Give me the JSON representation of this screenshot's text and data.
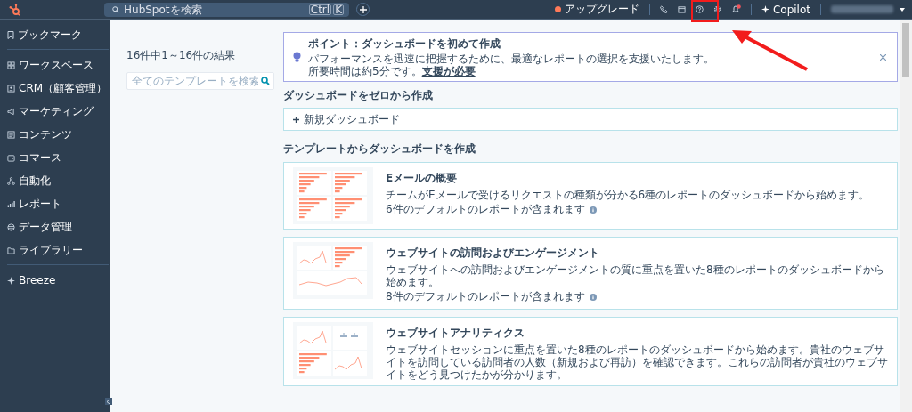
{
  "topbar": {
    "search": {
      "placeholder": "HubSpotを検索",
      "shortcut": [
        "Ctrl",
        "K"
      ]
    },
    "upgrade": "アップグレード",
    "copilot": "Copilot"
  },
  "sidebar": {
    "bookmarks": "ブックマーク",
    "items": [
      "ワークスペース",
      "CRM（顧客管理）",
      "マーケティング",
      "コンテンツ",
      "コマース",
      "自動化",
      "レポート",
      "データ管理",
      "ライブラリー"
    ],
    "breeze": "Breeze"
  },
  "filters": {
    "result_count": "16件中1～16件の結果",
    "search": {
      "placeholder": "全てのテンプレートを検索"
    }
  },
  "tip": {
    "title": "ポイント：ダッシュボードを初めて作成",
    "body": "パフォーマンスを迅速に把握するために、最適なレポートの選択を支援いたします。所要時間は約5分です。",
    "link": "支援が必要"
  },
  "scratch": {
    "heading": "ダッシュボードをゼロから作成",
    "new_button": "新規ダッシュボード"
  },
  "templates": {
    "heading": "テンプレートからダッシュボードを作成",
    "cards": [
      {
        "title": "Eメールの概要",
        "description": "チームがEメールで受けるリクエストの種類が分かる6種のレポートのダッシュボードから始めます。",
        "reports": "6件のデフォルトのレポートが含まれます"
      },
      {
        "title": "ウェブサイトの訪問およびエンゲージメント",
        "description": "ウェブサイトへの訪問およびエンゲージメントの質に重点を置いた8種のレポートのダッシュボードから始めます。",
        "reports": "8件のデフォルトのレポートが含まれます"
      },
      {
        "title": "ウェブサイトアナリティクス",
        "description": "ウェブサイトセッションに重点を置いた8種のレポートのダッシュボードから始めます。貴社のウェブサイトを訪問している訪問者の人数（新規および再訪）を確認できます。これらの訪問者が貴社のウェブサイトをどう見つけたかが分かります。"
      }
    ]
  }
}
